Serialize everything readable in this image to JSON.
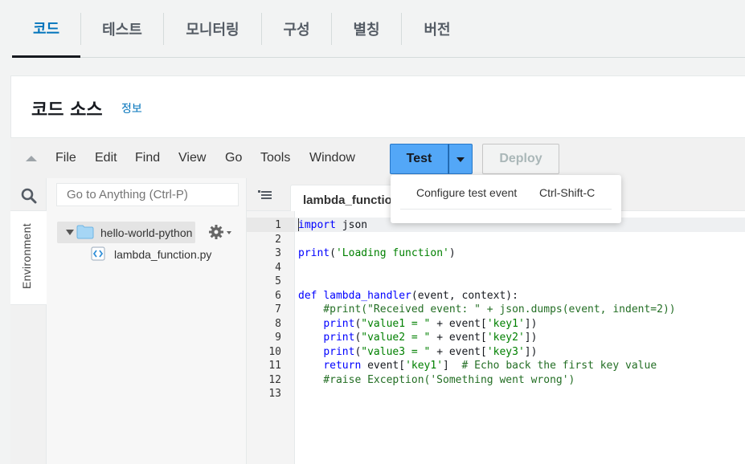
{
  "tabs": [
    {
      "label": "코드",
      "active": true
    },
    {
      "label": "테스트"
    },
    {
      "label": "모니터링"
    },
    {
      "label": "구성"
    },
    {
      "label": "별칭"
    },
    {
      "label": "버전"
    }
  ],
  "panel": {
    "title": "코드 소스",
    "info_link": "정보"
  },
  "menubar": {
    "items": [
      "File",
      "Edit",
      "Find",
      "View",
      "Go",
      "Tools",
      "Window"
    ],
    "test_label": "Test",
    "deploy_label": "Deploy"
  },
  "test_dropdown": {
    "item": "Configure test event",
    "shortcut": "Ctrl-Shift-C"
  },
  "sidebar": {
    "environment_label": "Environment",
    "goto_placeholder": "Go to Anything (Ctrl-P)"
  },
  "file_tree": {
    "root": "hello-world-python",
    "file": "lambda_function.py"
  },
  "editor": {
    "tab_label": "lambda_function.py",
    "line_numbers": [
      "1",
      "2",
      "3",
      "4",
      "5",
      "6",
      "7",
      "8",
      "9",
      "10",
      "11",
      "12",
      "13"
    ]
  },
  "colors": {
    "accent": "#0073bb",
    "test_button": "#53a7f7",
    "keyword": "#0000ff",
    "string": "#008000"
  }
}
